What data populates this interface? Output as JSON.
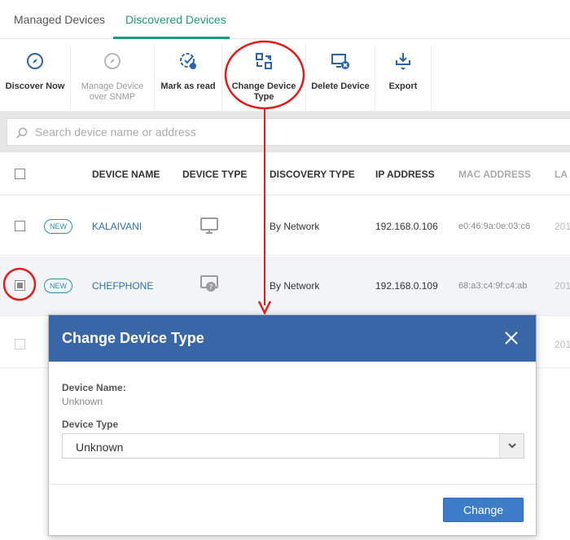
{
  "tabs": [
    {
      "label": "Managed Devices",
      "active": false
    },
    {
      "label": "Discovered Devices",
      "active": true
    }
  ],
  "toolbar": {
    "discover_now": "Discover Now",
    "manage_snmp": "Manage Device over SNMP",
    "manage_snmp_line1": "Manage Device",
    "manage_snmp_line2": "over SNMP",
    "mark_as_read": "Mark as read",
    "change_type_line1": "Change Device",
    "change_type_line2": "Type",
    "delete_device": "Delete Device",
    "export": "Export"
  },
  "search": {
    "placeholder": "Search device name or address"
  },
  "table": {
    "columns": [
      "DEVICE NAME",
      "DEVICE TYPE",
      "DISCOVERY TYPE",
      "IP ADDRESS",
      "MAC ADDRESS",
      "LA"
    ],
    "rows": [
      {
        "badge": "NEW",
        "name": "KALAIVANI",
        "device_icon": "monitor-icon",
        "discovery": "By Network",
        "ip": "192.168.0.106",
        "mac": "e0:46:9a:0e:03:c6",
        "last": "201",
        "checked": false
      },
      {
        "badge": "NEW",
        "name": "CHEFPHONE",
        "device_icon": "unknown-device-icon",
        "discovery": "By Network",
        "ip": "192.168.0.109",
        "mac": "68:a3:c4:9f:c4:ab",
        "last": "201",
        "checked": true
      },
      {
        "badge": "",
        "name": "",
        "device_icon": "",
        "discovery": "",
        "ip": "",
        "mac": "",
        "last": "201",
        "checked": false
      }
    ]
  },
  "modal": {
    "title": "Change Device Type",
    "device_name_label": "Device Name:",
    "device_name_value": "Unknown",
    "device_type_label": "Device Type",
    "device_type_selected": "Unknown",
    "change_button": "Change"
  },
  "colors": {
    "accent_green": "#1f9a7a",
    "modal_header": "#3866a6",
    "button_blue": "#3d7cc9",
    "link_blue": "#2a6fb0",
    "annotation_red": "#e21b1b"
  }
}
